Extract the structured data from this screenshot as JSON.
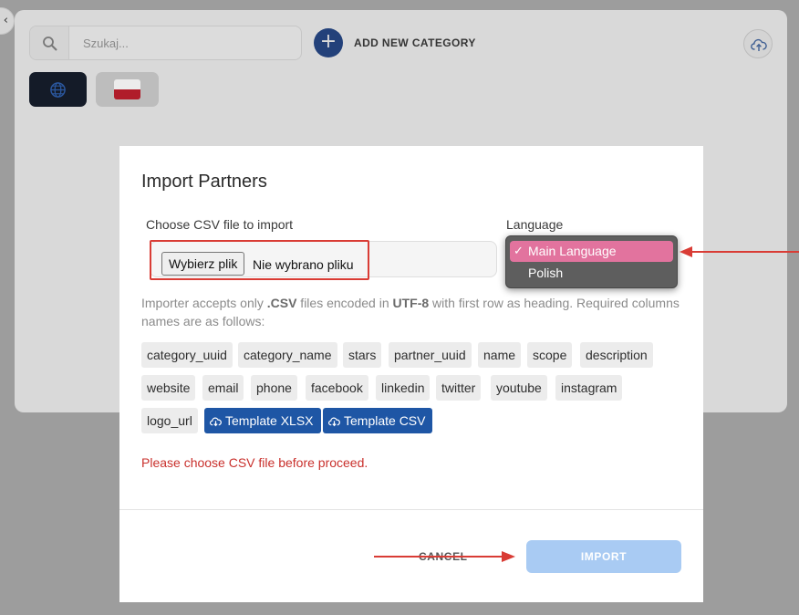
{
  "background": {
    "collapse_icon": "chevron-left-icon",
    "search": {
      "placeholder": "Szukaj...",
      "icon": "search-icon"
    },
    "add_category_label": "ADD NEW CATEGORY",
    "upload_icon": "cloud-upload-icon",
    "language_tabs": [
      {
        "icon": "globe-icon",
        "active": true
      },
      {
        "icon": "poland-flag-icon",
        "active": false
      }
    ]
  },
  "modal": {
    "title": "Import Partners",
    "file_label": "Choose CSV file to import",
    "file_button": "Wybierz plik",
    "file_status": "Nie wybrano pliku",
    "language_label": "Language",
    "language_options": [
      {
        "label": "Main Language",
        "selected": true
      },
      {
        "label": "Polish",
        "selected": false
      }
    ],
    "help": {
      "part1": "Importer accepts only ",
      "csv": ".CSV",
      "part2": " files encoded in ",
      "utf": "UTF-8",
      "part3": " with first row as heading. Required columns names are as follows:"
    },
    "columns": [
      "category_uuid",
      "category_name",
      "stars",
      "partner_uuid",
      "name",
      "scope",
      "description",
      "website",
      "email",
      "phone",
      "facebook",
      "linkedin",
      "twitter",
      "youtube",
      "instagram",
      "logo_url"
    ],
    "template_buttons": [
      "Template XLSX",
      "Template CSV"
    ],
    "error": "Please choose CSV file before proceed.",
    "cancel_label": "CANCEL",
    "import_label": "IMPORT"
  },
  "colors": {
    "overlay": "#9d9d9d",
    "primary": "#1e56a5",
    "selected_option": "#e2739e",
    "error": "#c9302c",
    "annotation": "#d93c35",
    "import_disabled": "#a9cbf3"
  }
}
